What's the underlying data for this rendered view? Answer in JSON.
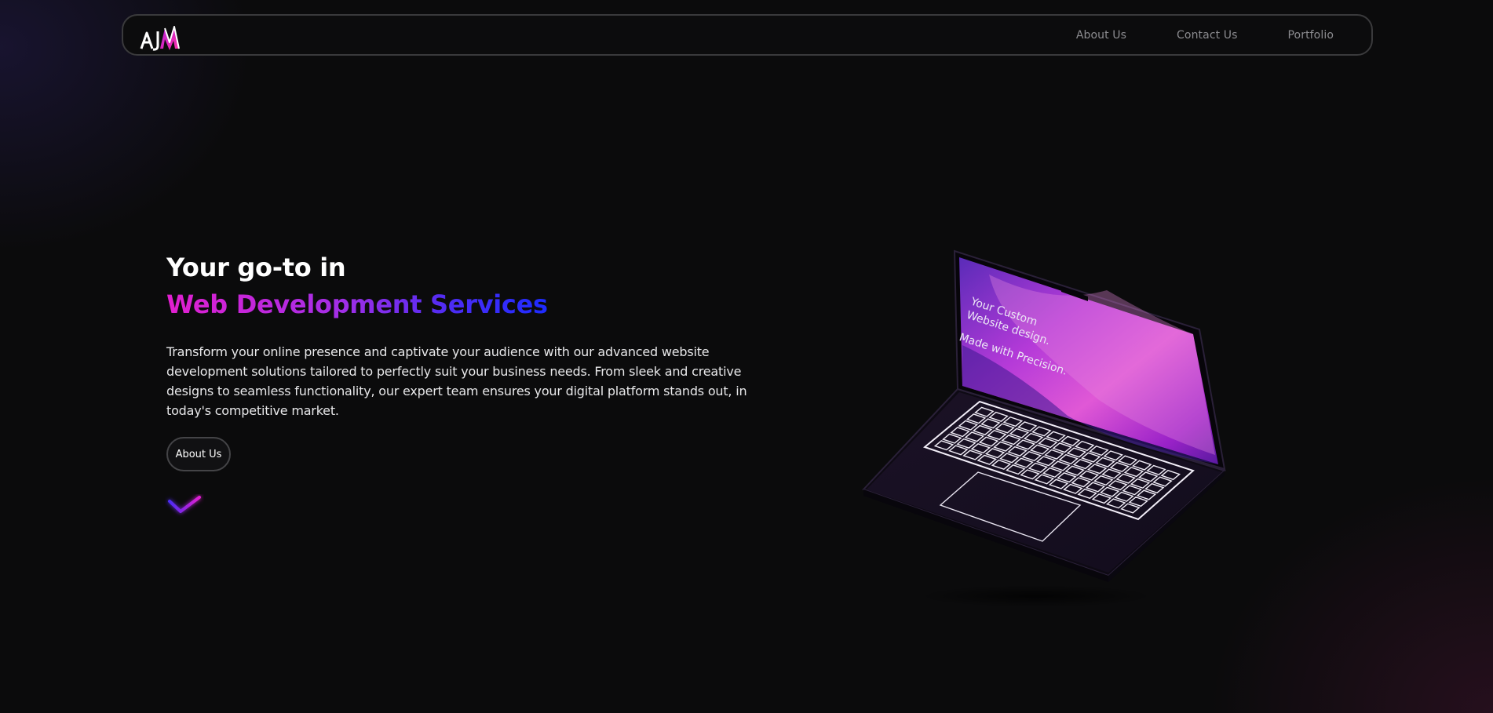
{
  "nav": {
    "logo_text": "AJM",
    "links": [
      "About Us",
      "Contact Us",
      "Portfolio"
    ]
  },
  "hero": {
    "line1": "Your go-to in",
    "line2": "Web Development Services",
    "description": "Transform your online presence and captivate your audience with our advanced website development solutions tailored to perfectly suit your business needs. From sleek and creative designs to seamless functionality, our expert team ensures your digital platform stands out, in today's competitive market.",
    "button_label": "About Us"
  },
  "laptop_screen": {
    "line1": "Your Custom",
    "line2": "Website design.",
    "line3": "Made with Precision."
  },
  "colors": {
    "background": "#0b0b0c",
    "accent_pink": "#e21fd0",
    "accent_blue": "#1d2bff",
    "nav_text": "#8c8c90"
  },
  "icons": {
    "scroll_indicator": "chevron-down-icon"
  }
}
